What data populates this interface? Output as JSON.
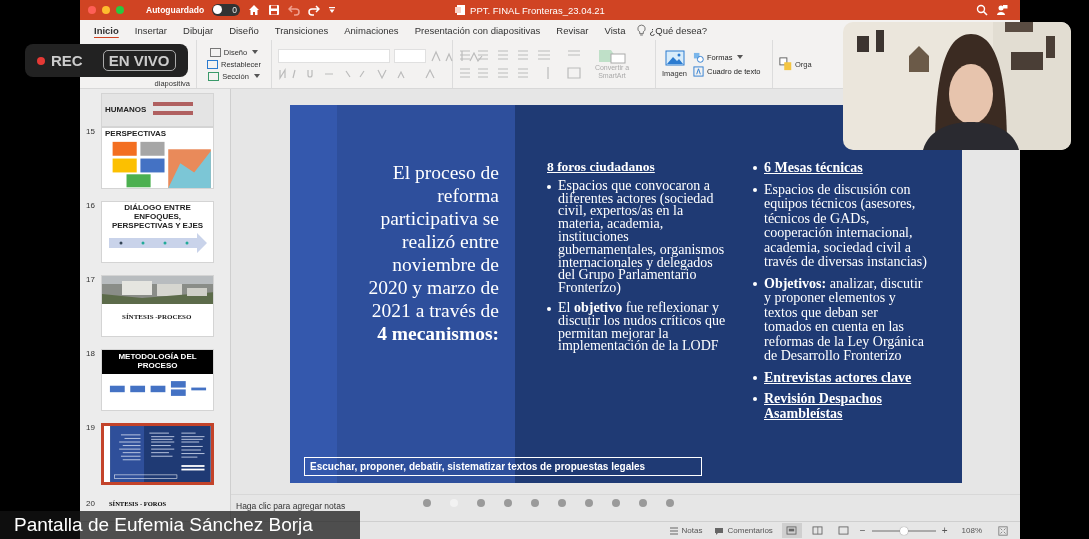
{
  "rec_badge": {
    "recording": "REC",
    "live": "EN VIVO"
  },
  "title_bar": {
    "autosave_label": "Autoguardado",
    "autosave_on": false,
    "autosave_toggle_text": "0",
    "document_title": "PPT. FINAL Fronteras_23.04.21"
  },
  "tabs": [
    {
      "label": "Inicio",
      "selected": true
    },
    {
      "label": "Insertar",
      "selected": false
    },
    {
      "label": "Dibujar",
      "selected": false
    },
    {
      "label": "Diseño",
      "selected": false
    },
    {
      "label": "Transiciones",
      "selected": false
    },
    {
      "label": "Animaciones",
      "selected": false
    },
    {
      "label": "Presentación con diapositivas",
      "selected": false
    },
    {
      "label": "Revisar",
      "selected": false
    },
    {
      "label": "Vista",
      "selected": false
    }
  ],
  "tell_me": "¿Qué desea?",
  "ribbon": {
    "new_slide_label": "diapositiva",
    "layout": "Diseño",
    "reset": "Restablecer",
    "section": "Sección",
    "convert_smartart": "Convertir a SmartArt",
    "image": "Imagen",
    "shapes": "Formas",
    "text_box": "Cuadro de texto",
    "cut_label": "Orga"
  },
  "thumbnails": [
    {
      "kind": "list",
      "title": "HUMANOS",
      "selected": false
    },
    {
      "kind": "boxes",
      "number": "15",
      "title": "PERSPECTIVAS",
      "selected": false
    },
    {
      "kind": "arrow",
      "number": "16",
      "title": "DIÁLOGO ENTRE ENFOQUES, PERSPECTIVAS Y EJES",
      "selected": false
    },
    {
      "number": "17",
      "title": "SÍNTESIS -PROCESO",
      "selected": false
    },
    {
      "kind": "flow",
      "number": "18",
      "title": "METODOLOGÍA DEL PROCESO",
      "selected": false
    },
    {
      "kind": "current",
      "number": "19",
      "selected": true
    },
    {
      "kind": "cut",
      "number": "20",
      "title": "SÍNTESIS - FOROS",
      "selected": false
    }
  ],
  "slide": {
    "title": "El proceso de reforma participativa se realizó entre noviembre de 2020 y marzo de 2021  a través de **4 mecanismos:**",
    "middle_column": {
      "heading": "8 foros ciudadanos",
      "bullets": [
        "Espacios que convocaron a diferentes actores (sociedad civil, expertos/as en la materia, academia, instituciones gubernamentales, organismos internacionales y delegados del Grupo Parlamentario Fronterizo)",
        "El **objetivo** fue reflexionar y discutir los nudos críticos que permitan mejorar la implementación de la LODF"
      ]
    },
    "right_column": [
      {
        "text": "6 Mesas técnicas",
        "underlined": true
      },
      {
        "text": "Espacios de discusión con equipos técnicos (asesores, técnicos de GADs, cooperación internacional, academia, sociedad civil a través de diversas instancias)",
        "underlined": false
      },
      {
        "text": "**Objetivos:** analizar, discutir y proponer elementos y textos que deban ser tomados en cuenta en las reformas de la Ley Orgánica de Desarrollo Fronterizo",
        "underlined": false
      },
      {
        "text": "Entrevistas actores clave",
        "underlined": true
      },
      {
        "text": "Revisión Despachos Asambleístas",
        "underlined": true
      }
    ],
    "footer_box": "Escuchar, proponer, debatir, sistematizar textos de propuestas legales"
  },
  "notes_placeholder": "Haga clic para agregar notas",
  "dots": [
    {
      "selected": false
    },
    {
      "selected": true
    },
    {
      "selected": false
    },
    {
      "selected": false
    },
    {
      "selected": false
    },
    {
      "selected": false
    },
    {
      "selected": false
    },
    {
      "selected": false
    },
    {
      "selected": false
    },
    {
      "selected": false
    }
  ],
  "status_bar": {
    "notes": "Notas",
    "comments": "Comentarios",
    "views": [
      {
        "selected": true
      },
      {
        "selected": false
      },
      {
        "selected": false
      }
    ],
    "zoom": {
      "minus": "−",
      "plus": "+",
      "level": 0.5,
      "reading": "108%"
    }
  },
  "caption": "Pantalla de Eufemia Sánchez Borja"
}
